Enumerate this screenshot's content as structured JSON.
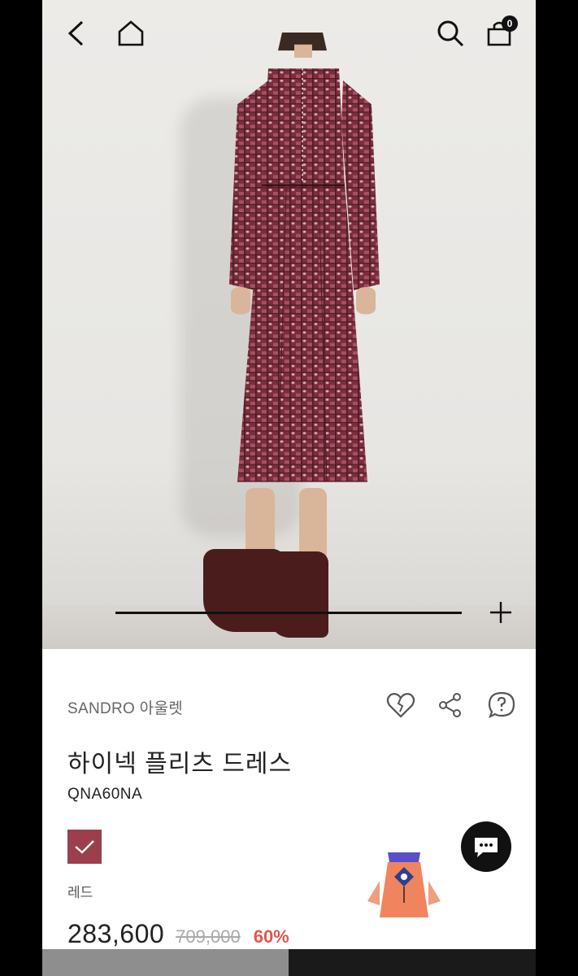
{
  "header": {
    "cart_count": "0"
  },
  "product": {
    "brand": "SANDRO 아울렛",
    "name": "하이넥 플리츠 드레스",
    "code": "QNA60NA",
    "color_label": "레드",
    "color_hex": "#9c3f4d",
    "price": "283,600",
    "original_price": "709,000",
    "discount": "60%"
  },
  "image_slider": {
    "position": 0
  },
  "bottom_bar": {
    "left_label": "",
    "right_label": ""
  },
  "colors": {
    "accent": "#e0574f",
    "dress": "#7a2e3b"
  }
}
